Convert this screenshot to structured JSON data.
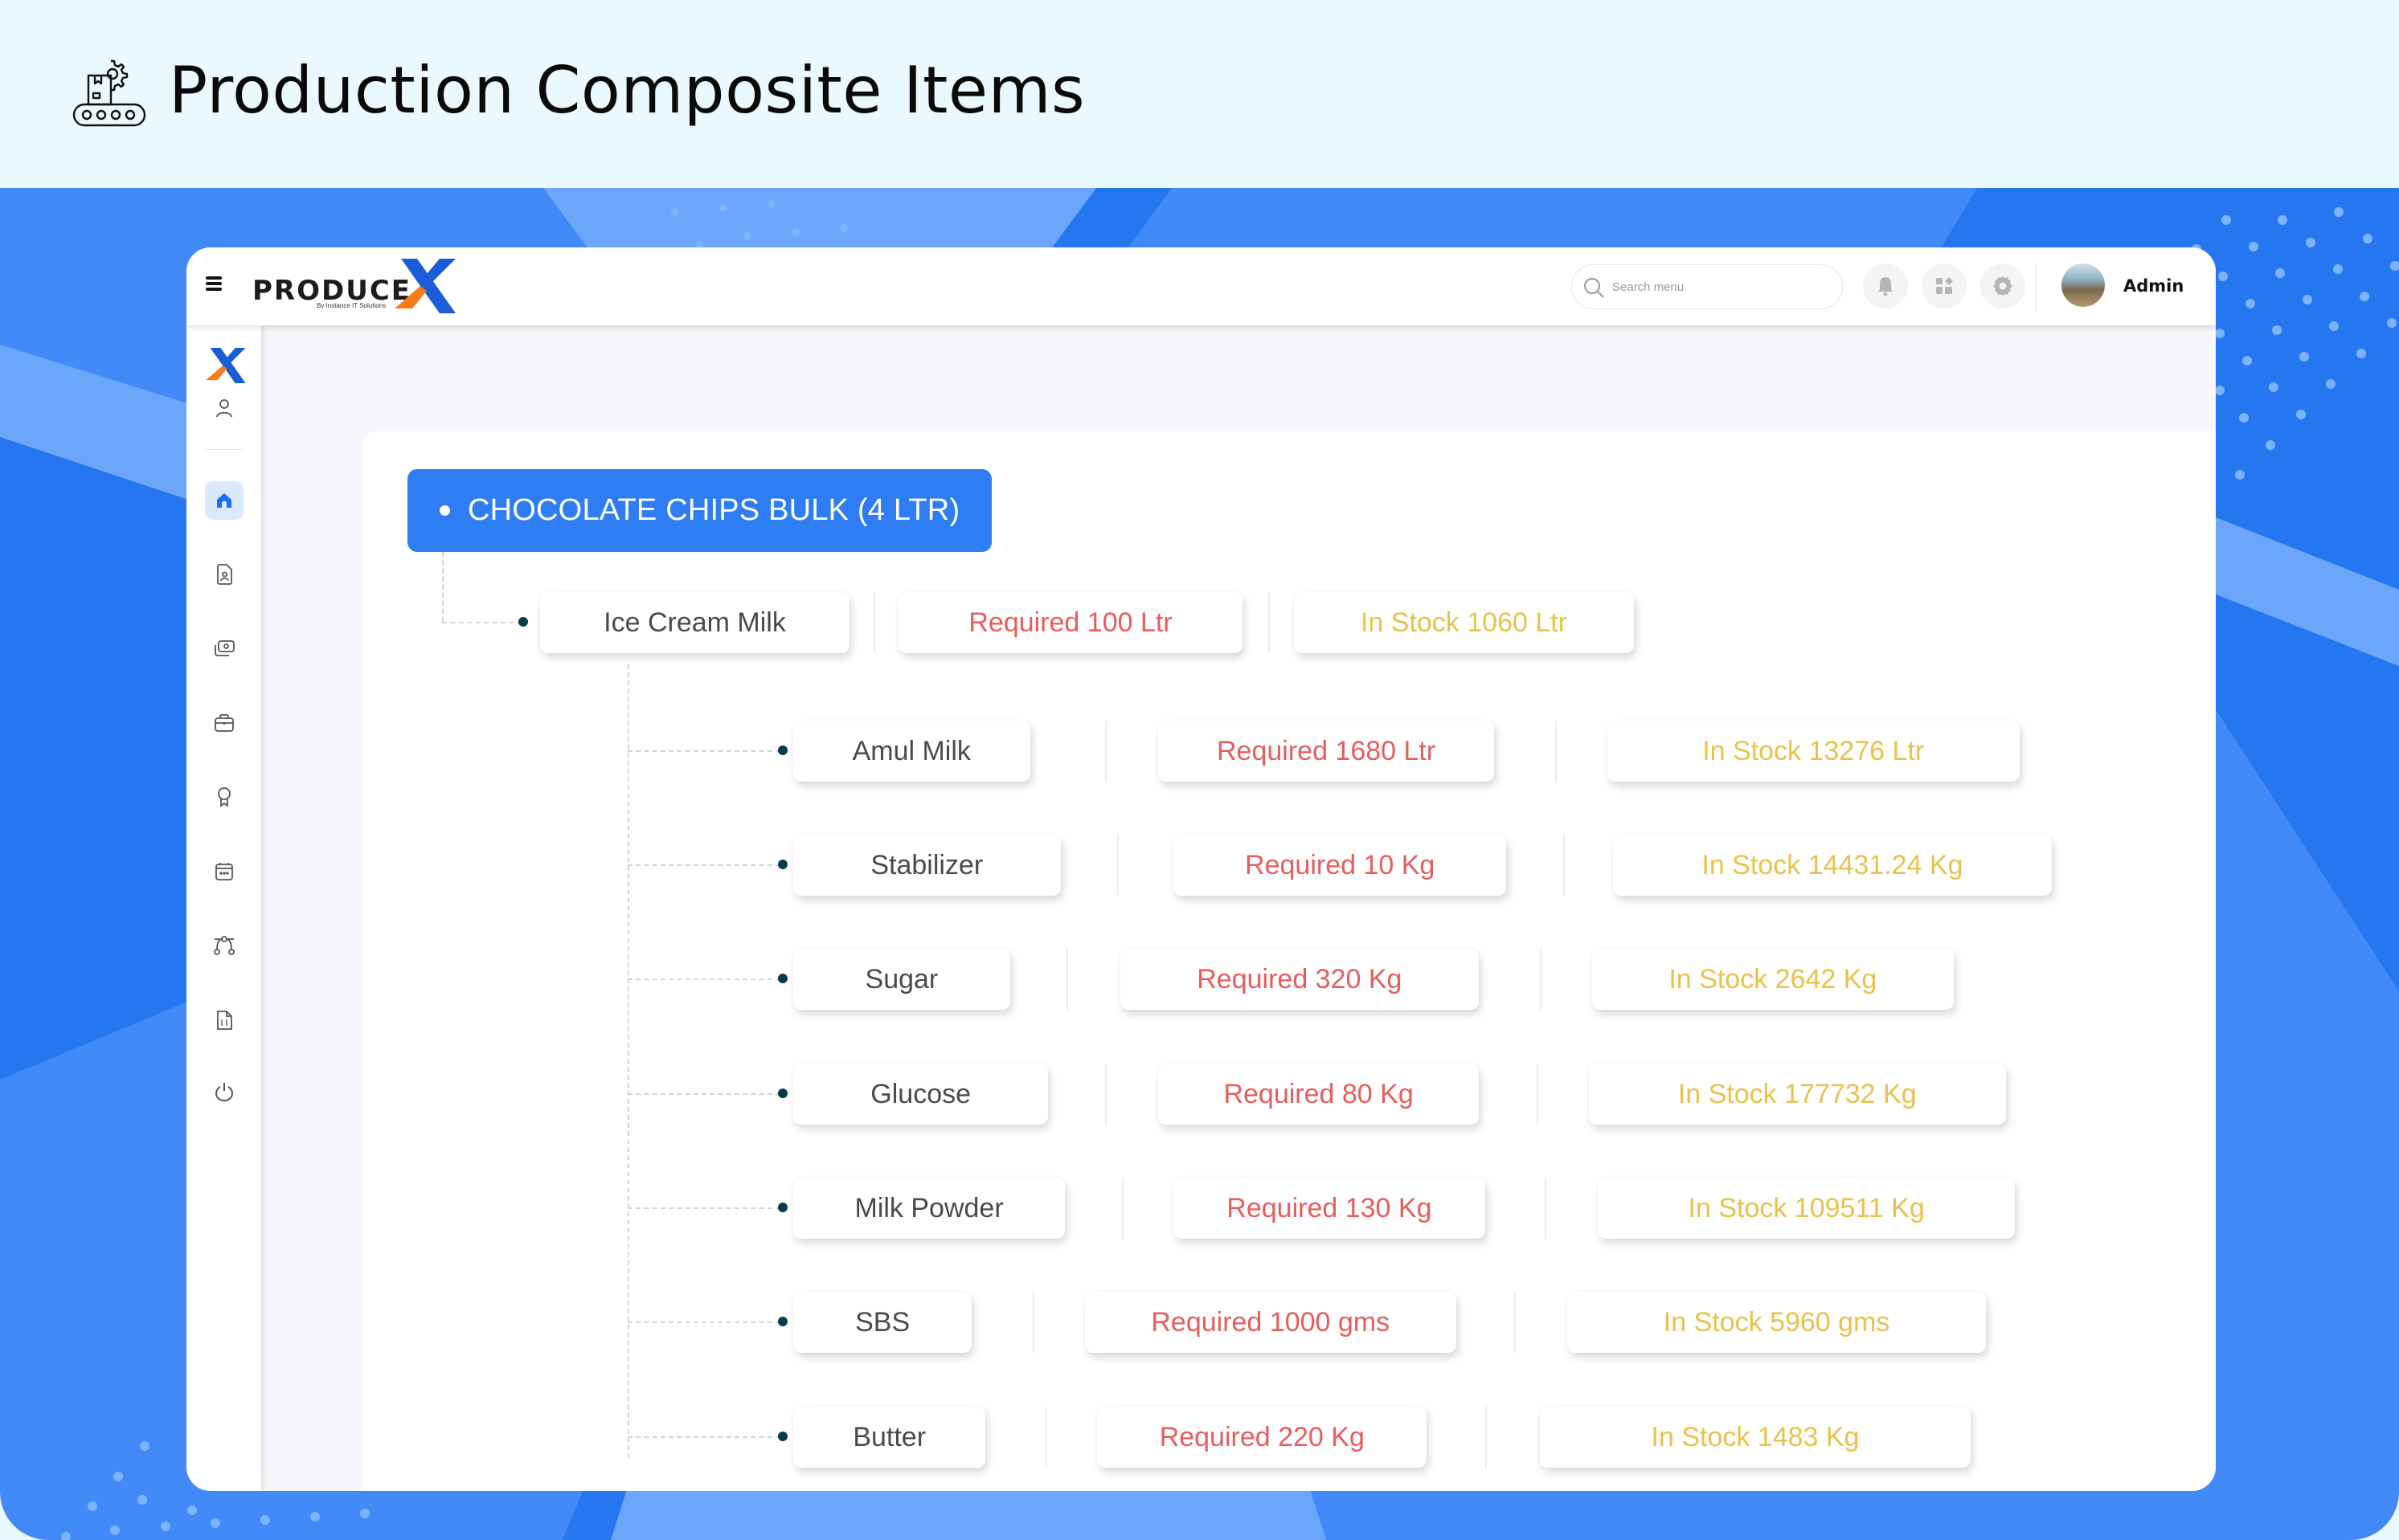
{
  "banner": {
    "title": "Production Composite Items",
    "icon": "conveyor-gear-icon"
  },
  "colors": {
    "banner_bg": "#e9f9fd",
    "blue_bg": "#418af7",
    "blue_light": "#6ca6fb",
    "blue_dark": "#2477ee",
    "root_node": "#2f7df3",
    "required_text": "#e85c5c",
    "stock_text": "#e8c24a",
    "name_text": "#4a4a4a",
    "tree_dot": "#073b4c"
  },
  "header": {
    "menu_icon": "hamburger-icon",
    "logo": {
      "text": "PRODUCE",
      "subtitle": "By Instance IT Solutions",
      "mark": "X"
    },
    "search": {
      "placeholder": "Search menu",
      "value": ""
    },
    "icons": [
      "bell-icon",
      "apps-grid-icon",
      "gear-icon"
    ],
    "user": {
      "name": "Admin"
    }
  },
  "sidebar": {
    "items": [
      {
        "icon": "user-icon",
        "label": "Profile",
        "active": false
      },
      {
        "icon": "home-icon",
        "label": "Home",
        "active": true
      },
      {
        "icon": "document-user-icon",
        "label": "Documents",
        "active": false
      },
      {
        "icon": "money-icon",
        "label": "Finance",
        "active": false
      },
      {
        "icon": "briefcase-icon",
        "label": "Business",
        "active": false
      },
      {
        "icon": "award-icon",
        "label": "Awards",
        "active": false
      },
      {
        "icon": "calendar-icon",
        "label": "Calendar",
        "active": false
      },
      {
        "icon": "vector-node-icon",
        "label": "Workflow",
        "active": false
      },
      {
        "icon": "file-code-icon",
        "label": "Reports",
        "active": false
      },
      {
        "icon": "power-icon",
        "label": "Logout",
        "active": false
      }
    ]
  },
  "tree": {
    "root": {
      "label": "CHOCOLATE CHIPS BULK (4 LTR)"
    },
    "level1": {
      "name": "Ice Cream Milk",
      "required": "Required 100 Ltr",
      "in_stock": "In Stock 1060 Ltr"
    },
    "level2": [
      {
        "name": "Amul Milk",
        "required": "Required 1680 Ltr",
        "in_stock": "In Stock 13276 Ltr"
      },
      {
        "name": "Stabilizer",
        "required": "Required 10 Kg",
        "in_stock": "In Stock 14431.24 Kg"
      },
      {
        "name": "Sugar",
        "required": "Required 320 Kg",
        "in_stock": "In Stock 2642 Kg"
      },
      {
        "name": "Glucose",
        "required": "Required 80 Kg",
        "in_stock": "In Stock 177732 Kg"
      },
      {
        "name": "Milk Powder",
        "required": "Required 130 Kg",
        "in_stock": "In Stock 109511 Kg"
      },
      {
        "name": "SBS",
        "required": "Required 1000 gms",
        "in_stock": "In Stock 5960 gms"
      },
      {
        "name": "Butter",
        "required": "Required 220 Kg",
        "in_stock": "In Stock 1483 Kg"
      }
    ]
  }
}
